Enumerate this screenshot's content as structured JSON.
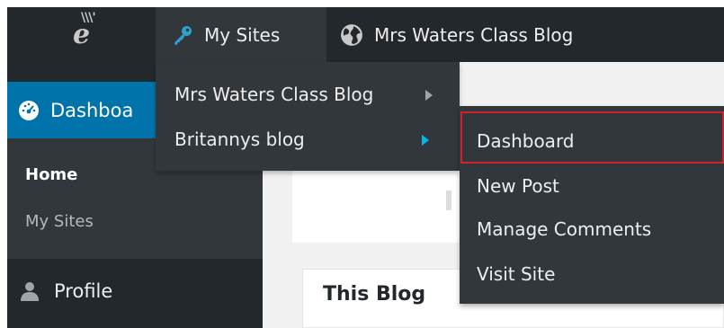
{
  "adminbar": {
    "logo_icon": "wordpress-logo-icon",
    "my_sites_label": "My Sites",
    "my_sites_icon": "key-icon",
    "blog_label": "Mrs Waters Class Blog",
    "blog_icon": "globe-icon"
  },
  "my_sites_menu": {
    "items": [
      {
        "label": "Mrs Waters Class Blog"
      },
      {
        "label": "Britannys blog"
      }
    ]
  },
  "flyout": {
    "items": [
      {
        "label": "Dashboard"
      },
      {
        "label": "New Post"
      },
      {
        "label": "Manage Comments"
      },
      {
        "label": "Visit Site"
      }
    ],
    "highlight_color": "#d2212b"
  },
  "sidebar": {
    "dashboard_label": "Dashboa",
    "dashboard_icon": "dashboard-gauge-icon",
    "sub_items": [
      {
        "label": "Home"
      },
      {
        "label": "My Sites"
      }
    ],
    "profile_label": "Profile",
    "profile_icon": "user-icon",
    "accent_color": "#0073aa"
  },
  "content": {
    "panel_title": "This Blog"
  }
}
